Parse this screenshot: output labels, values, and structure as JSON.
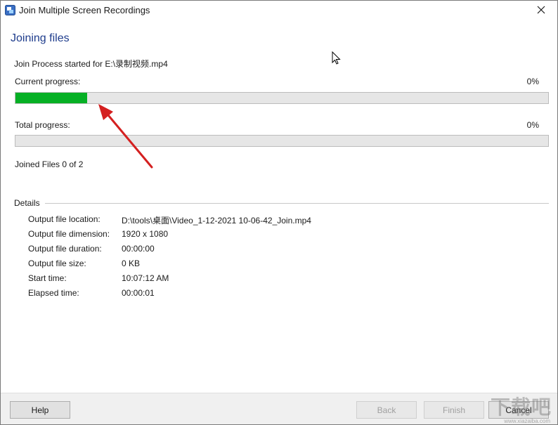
{
  "window": {
    "title": "Join Multiple Screen Recordings",
    "icon": "app-icon",
    "close_icon": "close-icon"
  },
  "main": {
    "page_title": "Joining files",
    "process_line": "Join Process started for E:\\录制视频.mp4",
    "current_progress": {
      "label": "Current progress:",
      "percent_text": "0%",
      "fill_fraction": 0.135,
      "fill_color": "#06b025"
    },
    "total_progress": {
      "label": "Total progress:",
      "percent_text": "0%",
      "fill_fraction": 0
    },
    "joined_files": "Joined Files 0 of 2"
  },
  "details": {
    "header": "Details",
    "rows": [
      {
        "label": "Output file location:",
        "value": "D:\\tools\\桌面\\Video_1-12-2021 10-06-42_Join.mp4"
      },
      {
        "label": "Output file dimension:",
        "value": "1920 x 1080"
      },
      {
        "label": "Output file duration:",
        "value": "00:00:00"
      },
      {
        "label": "Output file size:",
        "value": "0 KB"
      },
      {
        "label": "Start time:",
        "value": "10:07:12 AM"
      },
      {
        "label": "Elapsed time:",
        "value": "00:00:01"
      }
    ]
  },
  "footer": {
    "help_label": "Help",
    "back_label": "Back",
    "finish_label": "Finish",
    "cancel_label": "Cancel"
  },
  "colors": {
    "title_blue": "#1e3c8c",
    "progress_green": "#06b025",
    "arrow_red": "#d42020"
  },
  "watermark": {
    "text": "下载吧",
    "small": "www.xiazaiba.com"
  }
}
